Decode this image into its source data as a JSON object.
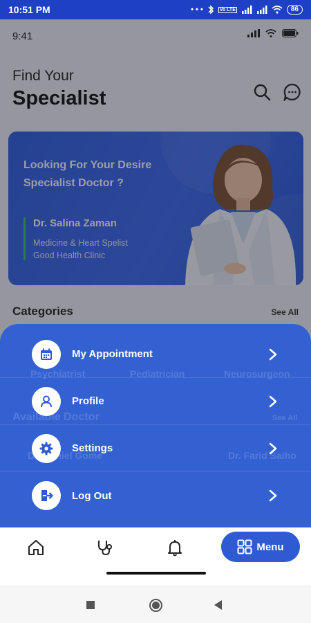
{
  "status_bar": {
    "time": "10:51 PM",
    "battery": "86",
    "net_badge": "Vo LTE"
  },
  "app": {
    "time": "9:41",
    "heading_small": "Find Your",
    "heading_large": "Specialist",
    "banner": {
      "title": "Looking For Your Desire Specialist Doctor ?",
      "doctor_name": "Dr. Salina Zaman",
      "doctor_specialty": "Medicine & Heart Spelist",
      "doctor_clinic": "Good Health Clinic"
    },
    "categories_title": "Categories",
    "categories_see_all": "See All",
    "behind_sheet": {
      "categories": [
        "Psychiatrist",
        "Pediatrician",
        "Neurosurgeon"
      ],
      "available_title": "Available Doctor",
      "available_see_all": "See All",
      "doctor_left": "Dr. Daniel Gome",
      "doctor_right": "Dr. Farid Saiho"
    }
  },
  "menu": {
    "items": [
      {
        "label": "My Appointment",
        "icon": "calendar-icon"
      },
      {
        "label": "Profile",
        "icon": "user-icon"
      },
      {
        "label": "Settings",
        "icon": "gear-icon"
      },
      {
        "label": "Log Out",
        "icon": "logout-icon"
      }
    ]
  },
  "bottom_nav": {
    "items": [
      "home-icon",
      "stethoscope-icon",
      "bell-icon"
    ],
    "menu_label": "Menu"
  },
  "colors": {
    "primary": "#2e5ad4",
    "status_bar": "#1e40c4",
    "accent_line": "#3ac46a"
  }
}
